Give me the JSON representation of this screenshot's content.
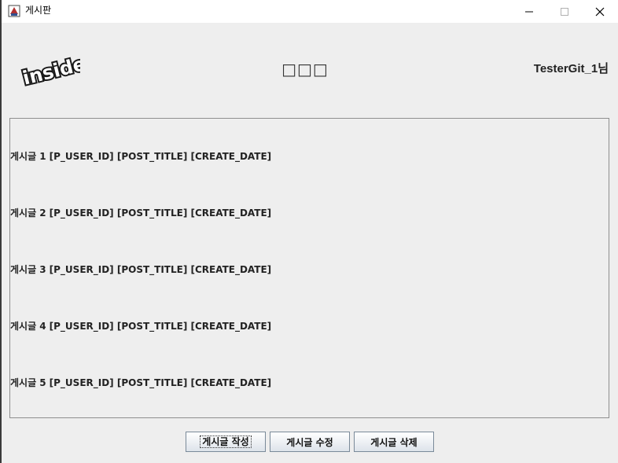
{
  "window": {
    "title": "게시판"
  },
  "header": {
    "title": "□□□",
    "user_label": "TesterGit_1님",
    "logo_text": "inside"
  },
  "posts": [
    {
      "label": "게시글 1",
      "fields": "[P_USER_ID] [POST_TITLE] [CREATE_DATE]"
    },
    {
      "label": "게시글 2",
      "fields": "[P_USER_ID] [POST_TITLE] [CREATE_DATE]"
    },
    {
      "label": "게시글 3",
      "fields": "[P_USER_ID] [POST_TITLE] [CREATE_DATE]"
    },
    {
      "label": "게시글 4",
      "fields": "[P_USER_ID] [POST_TITLE] [CREATE_DATE]"
    },
    {
      "label": "게시글 5",
      "fields": "[P_USER_ID] [POST_TITLE] [CREATE_DATE]"
    }
  ],
  "buttons": {
    "write_label": "게시글 작성",
    "edit_label": "게시글 수정",
    "delete_label": "게시글 삭제"
  },
  "icons": {
    "app": "java-cup-icon",
    "minimize": "minimize-icon",
    "maximize": "maximize-icon",
    "close": "close-icon"
  }
}
